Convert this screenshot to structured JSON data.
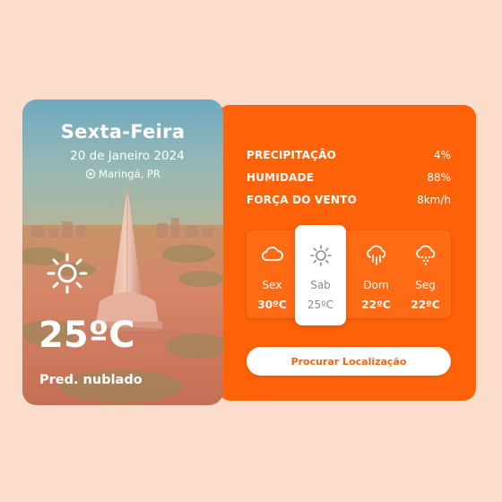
{
  "photo_card": {
    "weekday": "Sexta-Feira",
    "date": "20 de Janeiro 2024",
    "location": "Maringá, PR",
    "temperature": "25ºC",
    "condition": "Pred. nublado",
    "icon": "partly-sunny-icon"
  },
  "stats": [
    {
      "label": "PRECIPITAÇÃO",
      "value": "4%"
    },
    {
      "label": "HUMIDADE",
      "value": "88%"
    },
    {
      "label": "FORÇA DO VENTO",
      "value": "8km/h"
    }
  ],
  "forecast": [
    {
      "day": "Sex",
      "temp": "30ºC",
      "icon": "cloud-icon"
    },
    {
      "day": "Sab",
      "temp": "25ºC",
      "icon": "sun-icon",
      "selected": true
    },
    {
      "day": "Dom",
      "temp": "22ºC",
      "icon": "cloud-rain-icon"
    },
    {
      "day": "Seg",
      "temp": "22ºC",
      "icon": "cloud-hail-icon"
    }
  ],
  "search_button": "Procurar Localização",
  "colors": {
    "accent": "#ff6208",
    "background": "#fcdcca",
    "selected_card": "#ffffff"
  }
}
